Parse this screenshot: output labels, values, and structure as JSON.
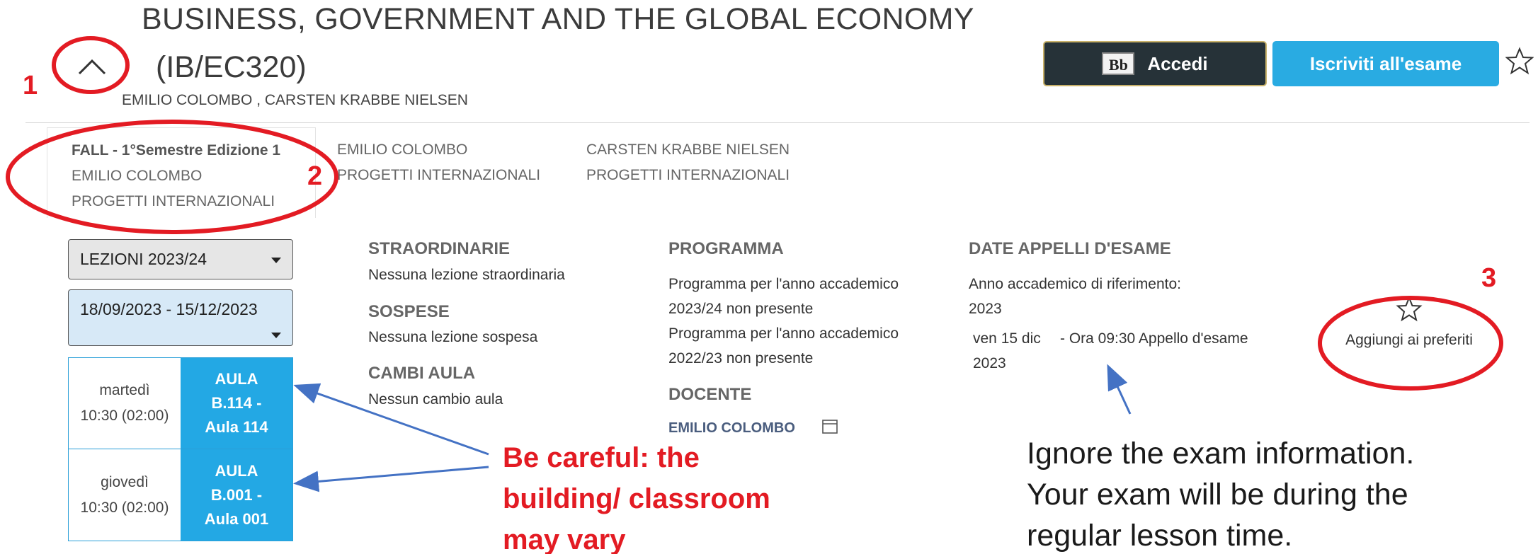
{
  "course": {
    "title": "BUSINESS, GOVERNMENT AND THE GLOBAL ECONOMY",
    "code": "(IB/EC320)",
    "instructors": "EMILIO COLOMBO , CARSTEN KRABBE NIELSEN"
  },
  "header_buttons": {
    "accedi_logo": "Bb",
    "accedi_label": "Accedi",
    "iscriviti_label": "Iscriviti all'esame"
  },
  "tabs": [
    {
      "title": "FALL - 1°Semestre Edizione 1",
      "teacher": "EMILIO COLOMBO",
      "dept": "PROGETTI INTERNAZIONALI"
    },
    {
      "teacher": "EMILIO COLOMBO",
      "dept": "PROGETTI INTERNAZIONALI"
    },
    {
      "teacher": "CARSTEN KRABBE NIELSEN",
      "dept": "PROGETTI INTERNAZIONALI"
    }
  ],
  "filters": {
    "lezioni": "LEZIONI 2023/24",
    "period": "18/09/2023 - 15/12/2023"
  },
  "schedule": [
    {
      "day": "martedì",
      "time": "10:30 (02:00)",
      "room_lines": [
        "AULA",
        "B.114 -",
        "Aula 114"
      ]
    },
    {
      "day": "giovedì",
      "time": "10:30 (02:00)",
      "room_lines": [
        "AULA",
        "B.001 -",
        "Aula 001"
      ]
    }
  ],
  "sections": {
    "straordinarie": {
      "heading": "STRAORDINARIE",
      "text": "Nessuna lezione straordinaria"
    },
    "sospese": {
      "heading": "SOSPESE",
      "text": "Nessuna lezione sospesa"
    },
    "cambi_aula": {
      "heading": "CAMBI AULA",
      "text": "Nessun cambio aula"
    },
    "programma": {
      "heading": "PROGRAMMA",
      "lines": [
        "Programma per l'anno accademico",
        "2023/24 non presente",
        "Programma per l'anno accademico",
        "2022/23 non presente"
      ]
    },
    "docente": {
      "heading": "DOCENTE",
      "name": "EMILIO COLOMBO"
    },
    "esami": {
      "heading": "DATE APPELLI D'ESAME",
      "ref_label": "Anno accademico di riferimento:",
      "ref_year": "2023",
      "date_line1": "ven 15 dic",
      "date_detail": "- Ora 09:30 Appello d'esame",
      "date_line2": "2023"
    }
  },
  "favorite": {
    "label": "Aggiungi ai preferiti"
  },
  "annotations": {
    "num1": "1",
    "num2": "2",
    "num3": "3",
    "red_note": [
      "Be careful: the",
      "building/ classroom",
      "may vary"
    ],
    "black_note": [
      "Ignore the exam information.",
      "Your exam will be during the",
      "regular lesson time."
    ]
  },
  "colors": {
    "accedi_bg": "#263238",
    "iscriviti_bg": "#29abe2",
    "room_bg": "#23a8e4",
    "annotation_red": "#e31b23",
    "arrow_blue": "#4472c4"
  }
}
